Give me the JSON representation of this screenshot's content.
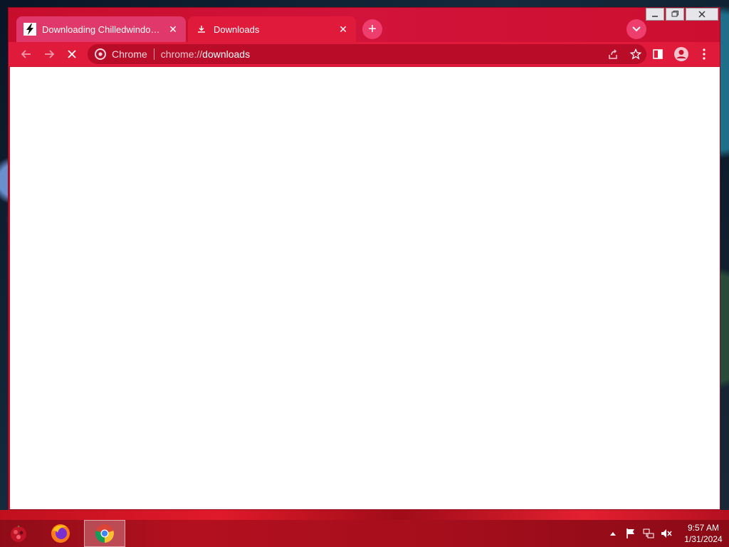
{
  "browser": {
    "tabs": [
      {
        "label": "Downloading Chilledwindows.exe",
        "icon": "lightning-icon",
        "active": false
      },
      {
        "label": "Downloads",
        "icon": "download-icon",
        "active": true
      }
    ],
    "new_tab_icon": "plus-icon",
    "tab_search_icon": "chevron-down-icon"
  },
  "toolbar": {
    "site_label": "Chrome",
    "url_prefix": "chrome://",
    "url_host": "downloads",
    "back_icon": "arrow-left-icon",
    "forward_icon": "arrow-right-icon",
    "stop_icon": "close-icon"
  },
  "taskbar": {
    "apps": [
      "start-icon",
      "firefox-icon",
      "chrome-icon"
    ],
    "clock": {
      "time": "9:57 AM",
      "date": "1/31/2024"
    }
  },
  "colors": {
    "frame": "#c90f2a",
    "toolbar": "#e01a3a",
    "omnibox": "#b80c28",
    "taskbar": "#a60e1c"
  }
}
